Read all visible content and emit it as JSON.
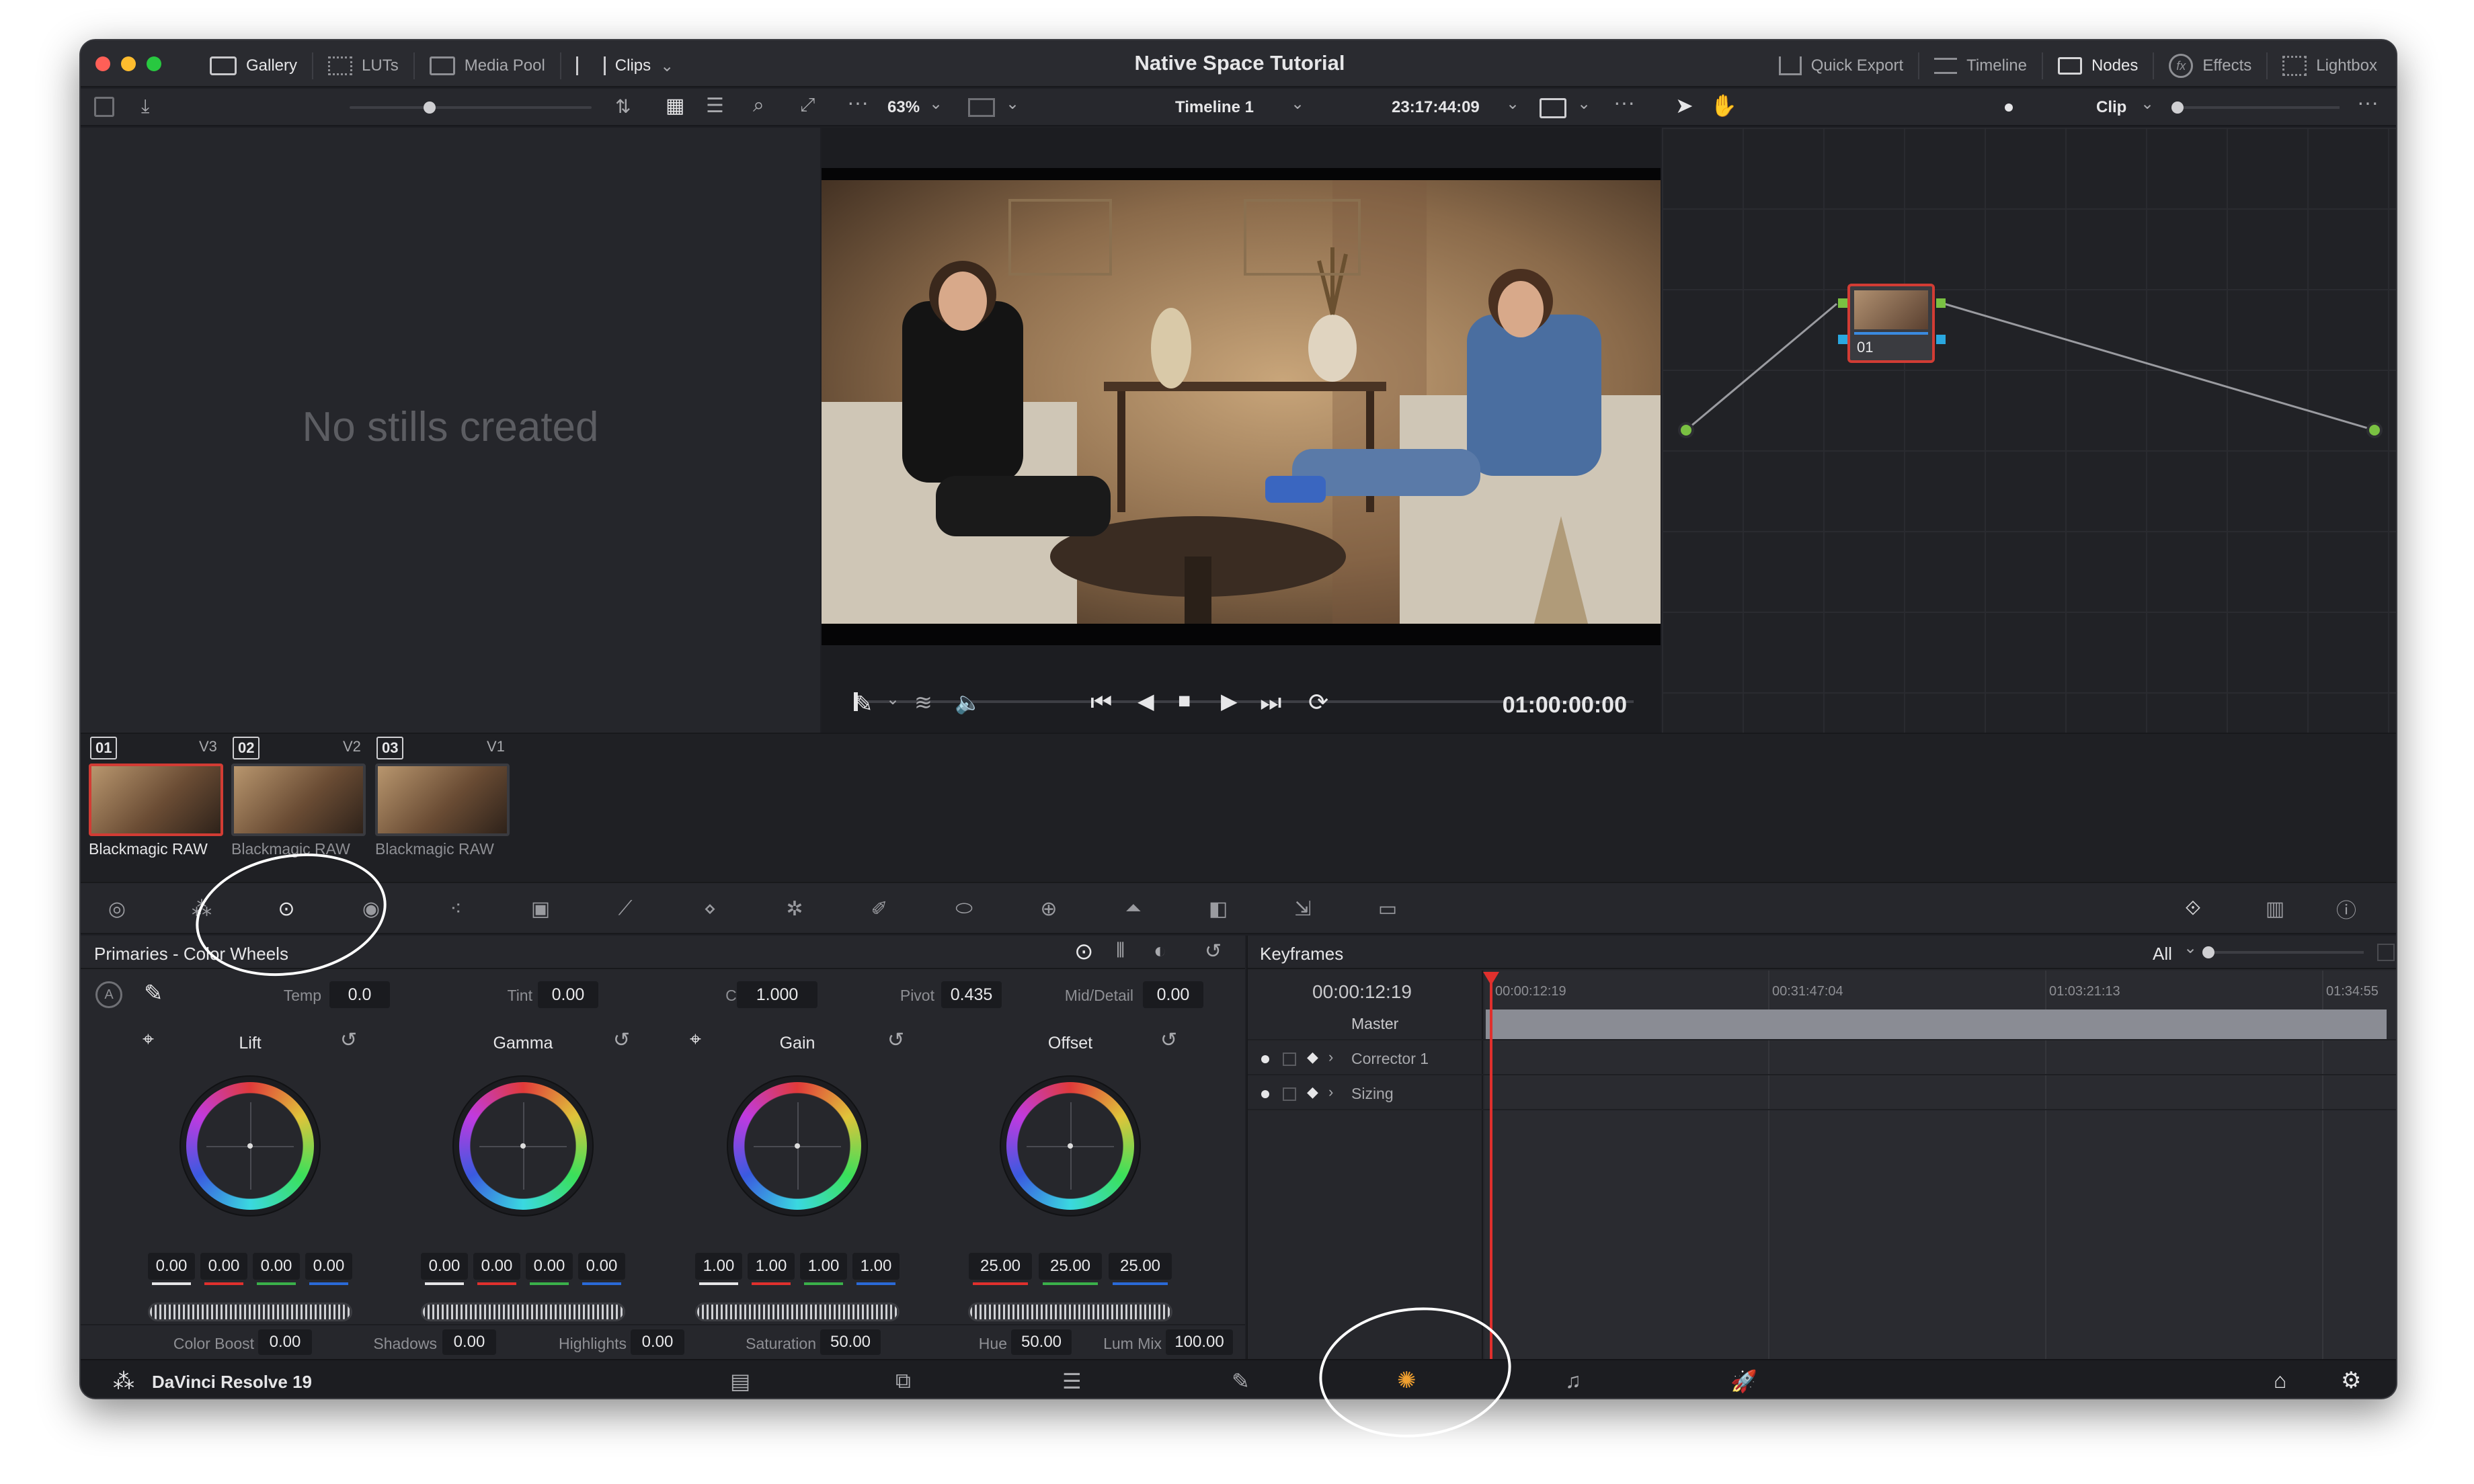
{
  "window": {
    "title": "Native Space Tutorial"
  },
  "topbar": {
    "left_tabs": [
      {
        "label": "Gallery",
        "icon": "gallery-icon"
      },
      {
        "label": "LUTs",
        "icon": "luts-icon"
      },
      {
        "label": "Media Pool",
        "icon": "media-pool-icon"
      },
      {
        "label": "Clips",
        "icon": "clips-icon"
      }
    ],
    "right_tabs": [
      {
        "label": "Quick Export",
        "icon": "export-icon"
      },
      {
        "label": "Timeline",
        "icon": "timeline-icon"
      },
      {
        "label": "Nodes",
        "icon": "nodes-icon"
      },
      {
        "label": "Effects",
        "icon": "fx-icon"
      },
      {
        "label": "Lightbox",
        "icon": "lightbox-icon"
      }
    ]
  },
  "viewer_bar": {
    "zoom": "63%",
    "timeline_name": "Timeline 1",
    "source_timecode": "23:17:44:09",
    "clip_mode": "Clip"
  },
  "gallery": {
    "empty_message": "No stills created"
  },
  "viewer": {
    "timecode": "01:00:00:00"
  },
  "node": {
    "label": "01"
  },
  "clips": [
    {
      "number": "01",
      "track": "V3",
      "name": "Blackmagic RAW",
      "selected": true
    },
    {
      "number": "02",
      "track": "V2",
      "name": "Blackmagic RAW",
      "selected": false
    },
    {
      "number": "03",
      "track": "V1",
      "name": "Blackmagic RAW",
      "selected": false
    }
  ],
  "primaries": {
    "title": "Primaries - Color Wheels",
    "adjust_row": [
      {
        "label": "Temp",
        "value": "0.0"
      },
      {
        "label": "Tint",
        "value": "0.00"
      },
      {
        "label": "Contrast",
        "value": "1.000"
      },
      {
        "label": "Pivot",
        "value": "0.435"
      },
      {
        "label": "Mid/Detail",
        "value": "0.00"
      }
    ],
    "wheels": [
      {
        "name": "Lift",
        "values": [
          "0.00",
          "0.00",
          "0.00",
          "0.00"
        ]
      },
      {
        "name": "Gamma",
        "values": [
          "0.00",
          "0.00",
          "0.00",
          "0.00"
        ]
      },
      {
        "name": "Gain",
        "values": [
          "1.00",
          "1.00",
          "1.00",
          "1.00"
        ]
      },
      {
        "name": "Offset",
        "values": [
          "25.00",
          "25.00",
          "25.00"
        ]
      }
    ],
    "bottom_row": [
      {
        "label": "Color Boost",
        "value": "0.00"
      },
      {
        "label": "Shadows",
        "value": "0.00"
      },
      {
        "label": "Highlights",
        "value": "0.00"
      },
      {
        "label": "Saturation",
        "value": "50.00"
      },
      {
        "label": "Hue",
        "value": "50.00"
      },
      {
        "label": "Lum Mix",
        "value": "100.00"
      }
    ]
  },
  "keyframes": {
    "title": "Keyframes",
    "filter": "All",
    "current_time": "00:00:12:19",
    "ruler": [
      "00:00:12:19",
      "00:31:47:04",
      "01:03:21:13",
      "01:34:55"
    ],
    "tracks": [
      "Master",
      "Corrector 1",
      "Sizing"
    ]
  },
  "footer": {
    "app_name": "DaVinci Resolve 19"
  },
  "colors": {
    "accent_red": "#e0302d",
    "playhead": "#e0302d",
    "node_border": "#d23c34"
  }
}
